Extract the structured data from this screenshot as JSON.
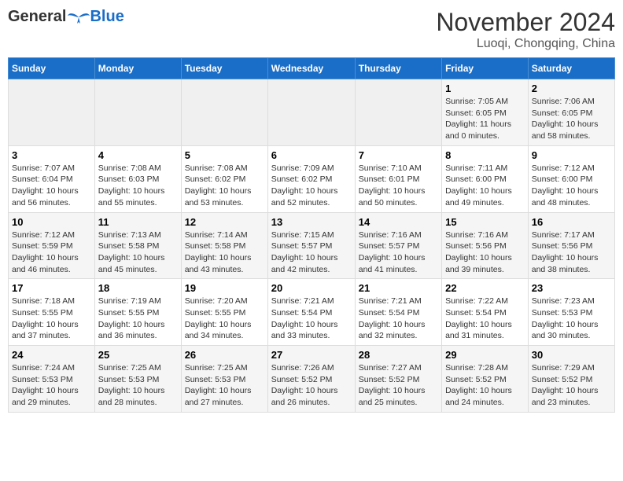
{
  "header": {
    "logo_general": "General",
    "logo_blue": "Blue",
    "month_title": "November 2024",
    "location": "Luoqi, Chongqing, China"
  },
  "weekdays": [
    "Sunday",
    "Monday",
    "Tuesday",
    "Wednesday",
    "Thursday",
    "Friday",
    "Saturday"
  ],
  "weeks": [
    [
      {
        "day": "",
        "info": ""
      },
      {
        "day": "",
        "info": ""
      },
      {
        "day": "",
        "info": ""
      },
      {
        "day": "",
        "info": ""
      },
      {
        "day": "",
        "info": ""
      },
      {
        "day": "1",
        "info": "Sunrise: 7:05 AM\nSunset: 6:05 PM\nDaylight: 11 hours and 0 minutes."
      },
      {
        "day": "2",
        "info": "Sunrise: 7:06 AM\nSunset: 6:05 PM\nDaylight: 10 hours and 58 minutes."
      }
    ],
    [
      {
        "day": "3",
        "info": "Sunrise: 7:07 AM\nSunset: 6:04 PM\nDaylight: 10 hours and 56 minutes."
      },
      {
        "day": "4",
        "info": "Sunrise: 7:08 AM\nSunset: 6:03 PM\nDaylight: 10 hours and 55 minutes."
      },
      {
        "day": "5",
        "info": "Sunrise: 7:08 AM\nSunset: 6:02 PM\nDaylight: 10 hours and 53 minutes."
      },
      {
        "day": "6",
        "info": "Sunrise: 7:09 AM\nSunset: 6:02 PM\nDaylight: 10 hours and 52 minutes."
      },
      {
        "day": "7",
        "info": "Sunrise: 7:10 AM\nSunset: 6:01 PM\nDaylight: 10 hours and 50 minutes."
      },
      {
        "day": "8",
        "info": "Sunrise: 7:11 AM\nSunset: 6:00 PM\nDaylight: 10 hours and 49 minutes."
      },
      {
        "day": "9",
        "info": "Sunrise: 7:12 AM\nSunset: 6:00 PM\nDaylight: 10 hours and 48 minutes."
      }
    ],
    [
      {
        "day": "10",
        "info": "Sunrise: 7:12 AM\nSunset: 5:59 PM\nDaylight: 10 hours and 46 minutes."
      },
      {
        "day": "11",
        "info": "Sunrise: 7:13 AM\nSunset: 5:58 PM\nDaylight: 10 hours and 45 minutes."
      },
      {
        "day": "12",
        "info": "Sunrise: 7:14 AM\nSunset: 5:58 PM\nDaylight: 10 hours and 43 minutes."
      },
      {
        "day": "13",
        "info": "Sunrise: 7:15 AM\nSunset: 5:57 PM\nDaylight: 10 hours and 42 minutes."
      },
      {
        "day": "14",
        "info": "Sunrise: 7:16 AM\nSunset: 5:57 PM\nDaylight: 10 hours and 41 minutes."
      },
      {
        "day": "15",
        "info": "Sunrise: 7:16 AM\nSunset: 5:56 PM\nDaylight: 10 hours and 39 minutes."
      },
      {
        "day": "16",
        "info": "Sunrise: 7:17 AM\nSunset: 5:56 PM\nDaylight: 10 hours and 38 minutes."
      }
    ],
    [
      {
        "day": "17",
        "info": "Sunrise: 7:18 AM\nSunset: 5:55 PM\nDaylight: 10 hours and 37 minutes."
      },
      {
        "day": "18",
        "info": "Sunrise: 7:19 AM\nSunset: 5:55 PM\nDaylight: 10 hours and 36 minutes."
      },
      {
        "day": "19",
        "info": "Sunrise: 7:20 AM\nSunset: 5:55 PM\nDaylight: 10 hours and 34 minutes."
      },
      {
        "day": "20",
        "info": "Sunrise: 7:21 AM\nSunset: 5:54 PM\nDaylight: 10 hours and 33 minutes."
      },
      {
        "day": "21",
        "info": "Sunrise: 7:21 AM\nSunset: 5:54 PM\nDaylight: 10 hours and 32 minutes."
      },
      {
        "day": "22",
        "info": "Sunrise: 7:22 AM\nSunset: 5:54 PM\nDaylight: 10 hours and 31 minutes."
      },
      {
        "day": "23",
        "info": "Sunrise: 7:23 AM\nSunset: 5:53 PM\nDaylight: 10 hours and 30 minutes."
      }
    ],
    [
      {
        "day": "24",
        "info": "Sunrise: 7:24 AM\nSunset: 5:53 PM\nDaylight: 10 hours and 29 minutes."
      },
      {
        "day": "25",
        "info": "Sunrise: 7:25 AM\nSunset: 5:53 PM\nDaylight: 10 hours and 28 minutes."
      },
      {
        "day": "26",
        "info": "Sunrise: 7:25 AM\nSunset: 5:53 PM\nDaylight: 10 hours and 27 minutes."
      },
      {
        "day": "27",
        "info": "Sunrise: 7:26 AM\nSunset: 5:52 PM\nDaylight: 10 hours and 26 minutes."
      },
      {
        "day": "28",
        "info": "Sunrise: 7:27 AM\nSunset: 5:52 PM\nDaylight: 10 hours and 25 minutes."
      },
      {
        "day": "29",
        "info": "Sunrise: 7:28 AM\nSunset: 5:52 PM\nDaylight: 10 hours and 24 minutes."
      },
      {
        "day": "30",
        "info": "Sunrise: 7:29 AM\nSunset: 5:52 PM\nDaylight: 10 hours and 23 minutes."
      }
    ]
  ]
}
